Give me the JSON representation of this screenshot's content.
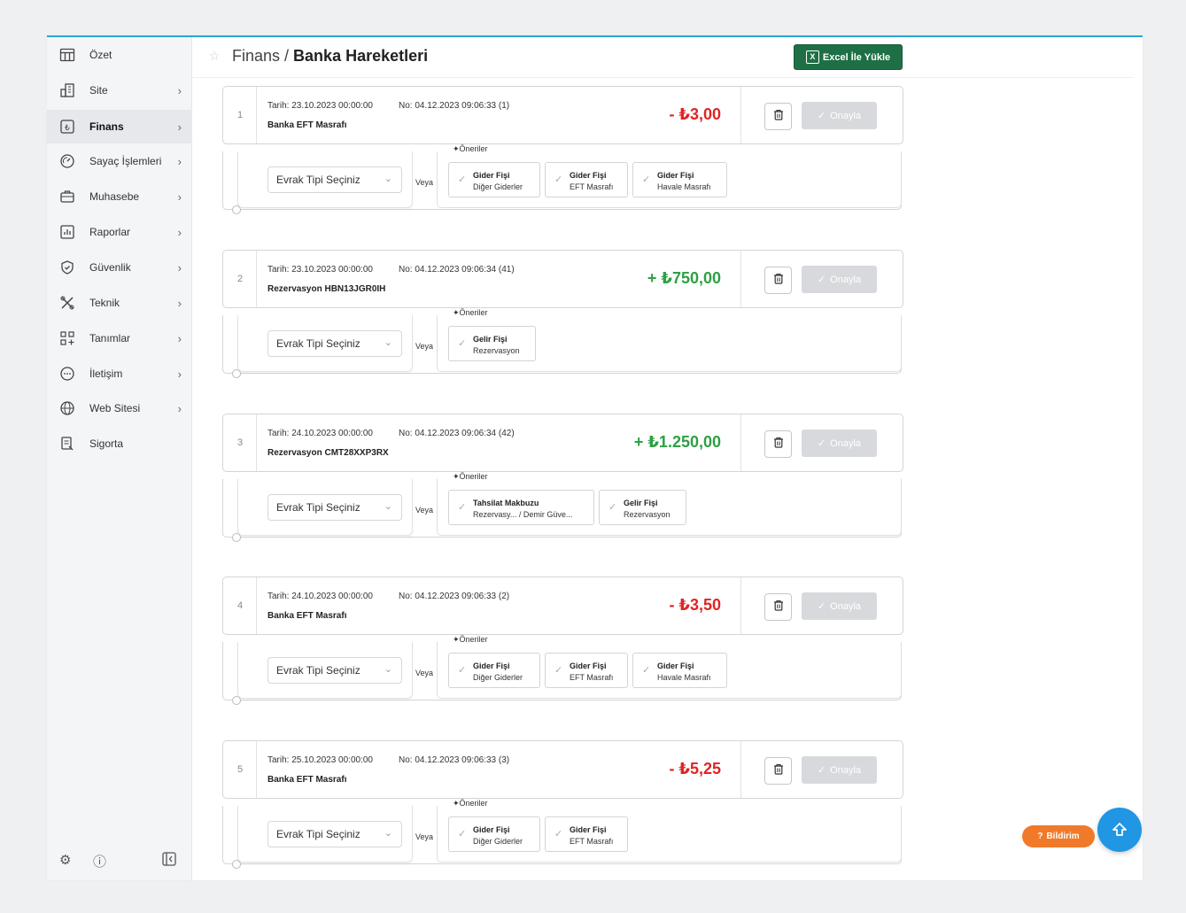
{
  "sidebar": {
    "items": [
      {
        "label": "Özet",
        "icon": "table-icon",
        "chevron": ""
      },
      {
        "label": "Site",
        "icon": "building-icon",
        "chevron": "›"
      },
      {
        "label": "Finans",
        "icon": "lira-icon",
        "chevron": "›"
      },
      {
        "label": "Sayaç İşlemleri",
        "icon": "gauge-icon",
        "chevron": "›"
      },
      {
        "label": "Muhasebe",
        "icon": "briefcase-icon",
        "chevron": "›"
      },
      {
        "label": "Raporlar",
        "icon": "chart-icon",
        "chevron": "›"
      },
      {
        "label": "Güvenlik",
        "icon": "shield-icon",
        "chevron": "›"
      },
      {
        "label": "Teknik",
        "icon": "tools-icon",
        "chevron": "›"
      },
      {
        "label": "Tanımlar",
        "icon": "grid-plus-icon",
        "chevron": "›"
      },
      {
        "label": "İletişim",
        "icon": "chat-icon",
        "chevron": "›"
      },
      {
        "label": "Web Sitesi",
        "icon": "globe-icon",
        "chevron": "›"
      },
      {
        "label": "Sigorta",
        "icon": "document-icon",
        "chevron": ""
      }
    ],
    "active_index": 2
  },
  "header": {
    "breadcrumb_parent": "Finans",
    "breadcrumb_sep": " / ",
    "breadcrumb_current": "Banka Hareketleri",
    "excel_button": "Excel İle Yükle"
  },
  "common": {
    "select_placeholder": "Evrak Tipi Seçiniz",
    "veya": "Veya",
    "oneriler": "Öneriler",
    "approve": "Onayla",
    "bildirim": "Bildirim"
  },
  "colors": {
    "negative": "#e02424",
    "positive": "#2ea043",
    "excel_green": "#1e6f45",
    "accent_blue": "#2196e3",
    "bildirim_orange": "#f07a2a"
  },
  "transactions": [
    {
      "num": "1",
      "tarih": "Tarih: 23.10.2023 00:00:00",
      "no": "No: 04.12.2023 09:06:33 (1)",
      "desc": "Banka EFT Masrafı",
      "amount": "- ₺3,00",
      "sign": "neg",
      "suggestions": [
        {
          "title": "Gider Fişi",
          "sub": "Diğer Giderler"
        },
        {
          "title": "Gider Fişi",
          "sub": "EFT Masrafı"
        },
        {
          "title": "Gider Fişi",
          "sub": "Havale Masrafı"
        }
      ]
    },
    {
      "num": "2",
      "tarih": "Tarih: 23.10.2023 00:00:00",
      "no": "No: 04.12.2023 09:06:34 (41)",
      "desc": "Rezervasyon HBN13JGR0IH",
      "amount": "+ ₺750,00",
      "sign": "pos",
      "suggestions": [
        {
          "title": "Gelir Fişi",
          "sub": "Rezervasyon"
        }
      ]
    },
    {
      "num": "3",
      "tarih": "Tarih: 24.10.2023 00:00:00",
      "no": "No: 04.12.2023 09:06:34 (42)",
      "desc": "Rezervasyon CMT28XXP3RX",
      "amount": "+ ₺1.250,00",
      "sign": "pos",
      "suggestions": [
        {
          "title": "Tahsilat Makbuzu",
          "sub": "Rezervasy... / Demir Güve..."
        },
        {
          "title": "Gelir Fişi",
          "sub": "Rezervasyon"
        }
      ]
    },
    {
      "num": "4",
      "tarih": "Tarih: 24.10.2023 00:00:00",
      "no": "No: 04.12.2023 09:06:33 (2)",
      "desc": "Banka EFT Masrafı",
      "amount": "- ₺3,50",
      "sign": "neg",
      "suggestions": [
        {
          "title": "Gider Fişi",
          "sub": "Diğer Giderler"
        },
        {
          "title": "Gider Fişi",
          "sub": "EFT Masrafı"
        },
        {
          "title": "Gider Fişi",
          "sub": "Havale Masrafı"
        }
      ]
    },
    {
      "num": "5",
      "tarih": "Tarih: 25.10.2023 00:00:00",
      "no": "No: 04.12.2023 09:06:33 (3)",
      "desc": "Banka EFT Masrafı",
      "amount": "- ₺5,25",
      "sign": "neg",
      "suggestions": [
        {
          "title": "Gider Fişi",
          "sub": "Diğer Giderler"
        },
        {
          "title": "Gider Fişi",
          "sub": "EFT Masrafı"
        }
      ]
    }
  ]
}
